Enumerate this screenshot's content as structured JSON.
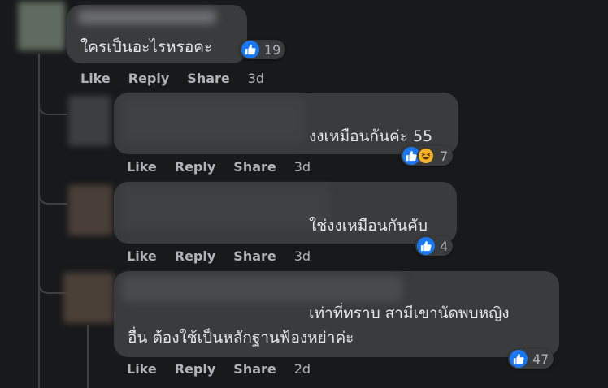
{
  "icons": {
    "like": "like-icon",
    "haha": "haha-icon"
  },
  "colors": {
    "background": "#18191a",
    "bubble": "#3a3b3c",
    "like_blue": "#1877f2",
    "action_text": "#b0b3b8",
    "comment_text": "#e4e6eb"
  },
  "comments": [
    {
      "text_lines": [
        "ใครเป็นอะไรหรอคะ"
      ],
      "reactions": [
        "like"
      ],
      "reaction_count": "19",
      "actions": {
        "like": "Like",
        "reply": "Reply",
        "share": "Share"
      },
      "timestamp": "3d"
    },
    {
      "text_lines": [
        "งงเหมือนกันค่ะ 55"
      ],
      "reactions": [
        "like",
        "haha"
      ],
      "reaction_count": "7",
      "actions": {
        "like": "Like",
        "reply": "Reply",
        "share": "Share"
      },
      "timestamp": "3d"
    },
    {
      "text_lines": [
        "ใช่งงเหมือนกันคับ"
      ],
      "reactions": [
        "like"
      ],
      "reaction_count": "4",
      "actions": {
        "like": "Like",
        "reply": "Reply",
        "share": "Share"
      },
      "timestamp": "3d"
    },
    {
      "text_lines": [
        "เท่าที่ทราบ สามีเขานัดพบหญิง",
        "อื่น ต้องใช้เป็นหลักฐานฟ้องหย่าค่ะ"
      ],
      "reactions": [
        "like"
      ],
      "reaction_count": "47",
      "actions": {
        "like": "Like",
        "reply": "Reply",
        "share": "Share"
      },
      "timestamp": "2d"
    }
  ]
}
